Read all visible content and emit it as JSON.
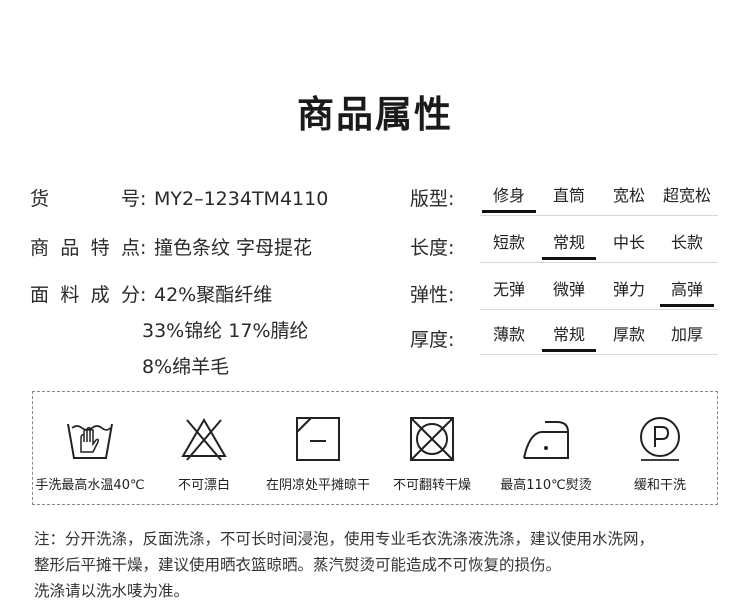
{
  "title": "商品属性",
  "attributes": [
    {
      "label": "货号",
      "value": "MY2–1234TM4110"
    },
    {
      "label": "商品特点",
      "value": "撞色条纹 字母提花"
    },
    {
      "label": "面料成分",
      "lines": [
        "42%聚酯纤维",
        "33%锦纶 17%腈纶",
        "8%绵羊毛"
      ]
    }
  ],
  "colon": ":",
  "options": [
    {
      "label": "版型:",
      "choices": [
        "修身",
        "直筒",
        "宽松",
        "超宽松"
      ],
      "selected": 0
    },
    {
      "label": "长度:",
      "choices": [
        "短款",
        "常规",
        "中长",
        "长款"
      ],
      "selected": 1
    },
    {
      "label": "弹性:",
      "choices": [
        "无弹",
        "微弹",
        "弹力",
        "高弹"
      ],
      "selected": 3
    },
    {
      "label": "厚度:",
      "choices": [
        "薄款",
        "常规",
        "厚款",
        "加厚"
      ],
      "selected": 1
    }
  ],
  "care": [
    {
      "icon": "hand-wash-icon",
      "label": "手洗最高水温40℃"
    },
    {
      "icon": "no-bleach-icon",
      "label": "不可漂白"
    },
    {
      "icon": "dry-flat-shade-icon",
      "label": "在阴凉处平摊晾干"
    },
    {
      "icon": "no-tumble-dry-icon",
      "label": "不可翻转干燥"
    },
    {
      "icon": "iron-icon",
      "label": "最高110℃熨烫"
    },
    {
      "icon": "dry-clean-p-icon",
      "label": "缓和干洗"
    }
  ],
  "notes": [
    "注：分开洗涤，反面洗涤，不可长时间浸泡，使用专业毛衣洗涤液洗涤，建议使用水洗网，",
    "整形后平摊干燥，建议使用晒衣篮晾晒。蒸汽熨烫可能造成不可恢复的损伤。",
    "洗涤请以洗水唛为准。"
  ]
}
